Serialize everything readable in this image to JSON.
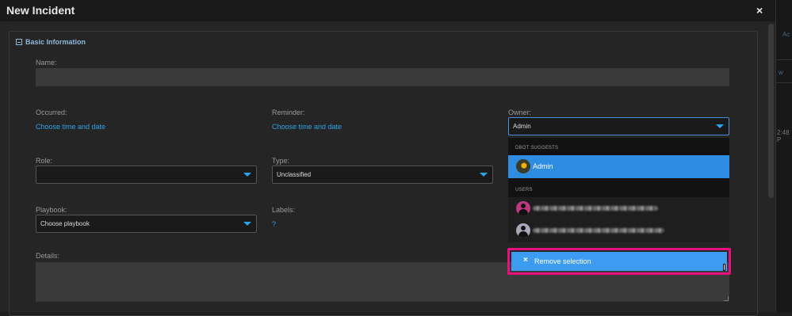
{
  "dialog": {
    "title": "New Incident",
    "close_label": "×"
  },
  "right_panel": {
    "text1": "Ac",
    "text2": "w",
    "text3": "2:48 P"
  },
  "section": {
    "title": "Basic Information"
  },
  "fields": {
    "name": {
      "label": "Name:",
      "value": ""
    },
    "occurred": {
      "label": "Occurred:",
      "link": "Choose time and date"
    },
    "reminder": {
      "label": "Reminder:",
      "link": "Choose time and date"
    },
    "owner": {
      "label": "Owner:",
      "value": "Admin"
    },
    "role": {
      "label": "Role:",
      "value": ""
    },
    "type": {
      "label": "Type:",
      "value": "Unclassified"
    },
    "playbook": {
      "label": "Playbook:",
      "value": "Choose playbook"
    },
    "labels": {
      "label": "Labels:",
      "link": "?"
    },
    "details": {
      "label": "Details:",
      "value": ""
    }
  },
  "owner_dropdown": {
    "suggest_header": "DBOT SUGGESTS",
    "suggested": [
      {
        "name": "Admin",
        "avatar": "admin-avatar"
      }
    ],
    "users_header": "USERS",
    "users": [
      {
        "avatar_color": "#c0397e",
        "name_redacted": true
      },
      {
        "avatar_color": "#a8a8b8",
        "name_redacted": true
      }
    ],
    "remove_label": "Remove selection",
    "remove_icon": "×",
    "highlight_color": "#e6107e"
  },
  "colors": {
    "accent": "#2aa3e8",
    "selected": "#2e8de0"
  }
}
